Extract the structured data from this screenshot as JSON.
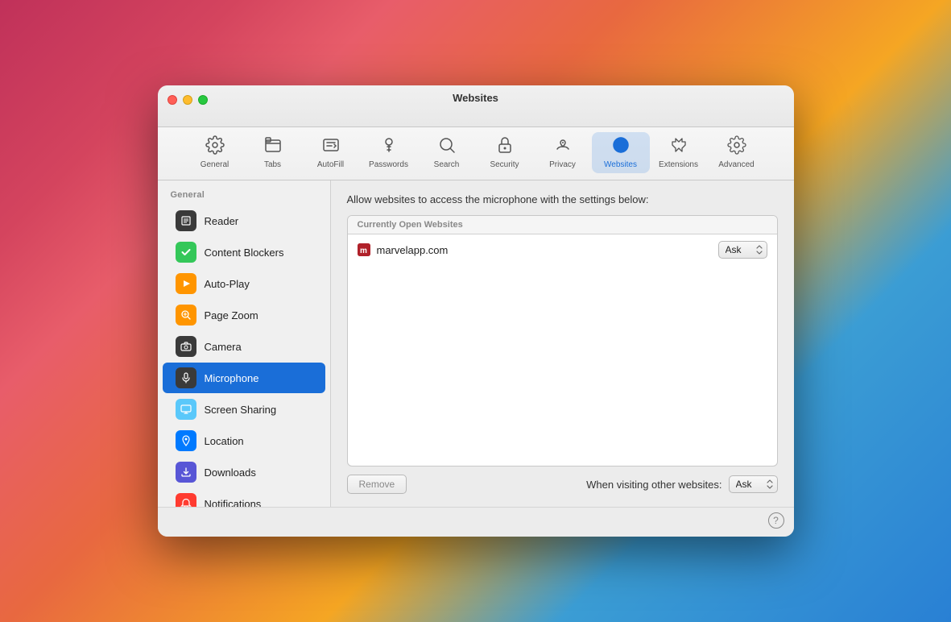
{
  "window": {
    "title": "Websites",
    "traffic_lights": {
      "close": "close",
      "minimize": "minimize",
      "maximize": "maximize"
    }
  },
  "toolbar": {
    "items": [
      {
        "id": "general",
        "label": "General",
        "icon": "⚙️"
      },
      {
        "id": "tabs",
        "label": "Tabs",
        "icon": "tabs"
      },
      {
        "id": "autofill",
        "label": "AutoFill",
        "icon": "autofill"
      },
      {
        "id": "passwords",
        "label": "Passwords",
        "icon": "🔑"
      },
      {
        "id": "search",
        "label": "Search",
        "icon": "🔍"
      },
      {
        "id": "security",
        "label": "Security",
        "icon": "🔒"
      },
      {
        "id": "privacy",
        "label": "Privacy",
        "icon": "privacy"
      },
      {
        "id": "websites",
        "label": "Websites",
        "icon": "🌐",
        "active": true
      },
      {
        "id": "extensions",
        "label": "Extensions",
        "icon": "extensions"
      },
      {
        "id": "advanced",
        "label": "Advanced",
        "icon": "advanced"
      }
    ]
  },
  "sidebar": {
    "section_header": "General",
    "items": [
      {
        "id": "reader",
        "label": "Reader",
        "icon": "📄",
        "bg": "reader"
      },
      {
        "id": "content-blockers",
        "label": "Content Blockers",
        "icon": "✓",
        "bg": "content-blockers"
      },
      {
        "id": "auto-play",
        "label": "Auto-Play",
        "icon": "▶",
        "bg": "auto-play"
      },
      {
        "id": "page-zoom",
        "label": "Page Zoom",
        "icon": "🔎",
        "bg": "page-zoom"
      },
      {
        "id": "camera",
        "label": "Camera",
        "icon": "📷",
        "bg": "camera"
      },
      {
        "id": "microphone",
        "label": "Microphone",
        "icon": "🎤",
        "bg": "microphone",
        "active": true
      },
      {
        "id": "screen-sharing",
        "label": "Screen Sharing",
        "icon": "🖥",
        "bg": "screen-sharing"
      },
      {
        "id": "location",
        "label": "Location",
        "icon": "➤",
        "bg": "location"
      },
      {
        "id": "downloads",
        "label": "Downloads",
        "icon": "⬇",
        "bg": "downloads"
      },
      {
        "id": "notifications",
        "label": "Notifications",
        "icon": "🔔",
        "bg": "notifications"
      }
    ]
  },
  "main": {
    "description": "Allow websites to access the microphone with the settings below:",
    "table": {
      "header": "Currently Open Websites",
      "rows": [
        {
          "site": "marvelapp.com",
          "permission": "Ask",
          "icon_letter": "m"
        }
      ]
    },
    "bottom": {
      "remove_label": "Remove",
      "other_websites_label": "When visiting other websites:",
      "other_permission": "Ask"
    }
  },
  "footer": {
    "help": "?"
  }
}
